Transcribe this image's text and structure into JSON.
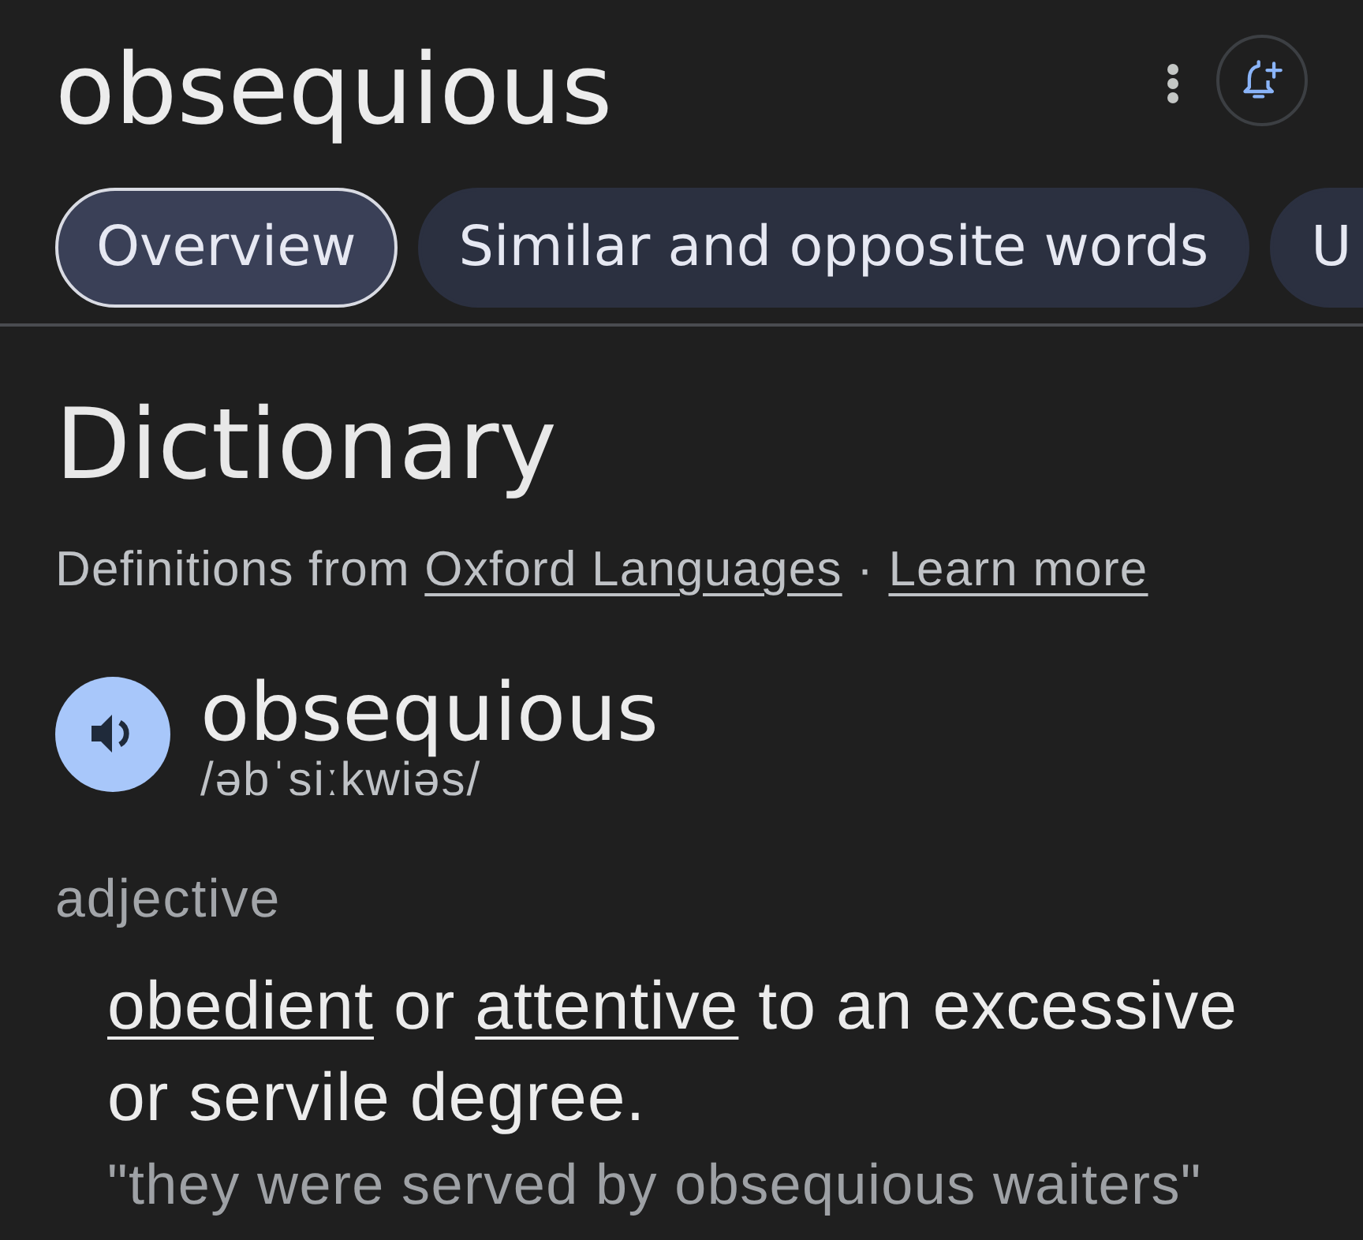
{
  "header": {
    "title": "obsequious"
  },
  "tabs": [
    {
      "label": "Overview",
      "selected": true
    },
    {
      "label": "Similar and opposite words",
      "selected": false
    },
    {
      "label": "U",
      "selected": false
    }
  ],
  "dictionary": {
    "heading": "Dictionary",
    "attribution": {
      "prefix": "Definitions from",
      "source_link": "Oxford Languages",
      "separator": "·",
      "learn_more_link": "Learn more"
    },
    "entry": {
      "word": "obsequious",
      "phonetic": "/əbˈsiːkwiəs/",
      "part_of_speech": "adjective",
      "definition": [
        {
          "kind": "link",
          "text": "obedient"
        },
        {
          "kind": "text",
          "text": "or"
        },
        {
          "kind": "link",
          "text": "attentive"
        },
        {
          "kind": "text",
          "text": "to an excessive or servile degree."
        }
      ],
      "example": "\"they were served by obsequious waiters\""
    }
  }
}
